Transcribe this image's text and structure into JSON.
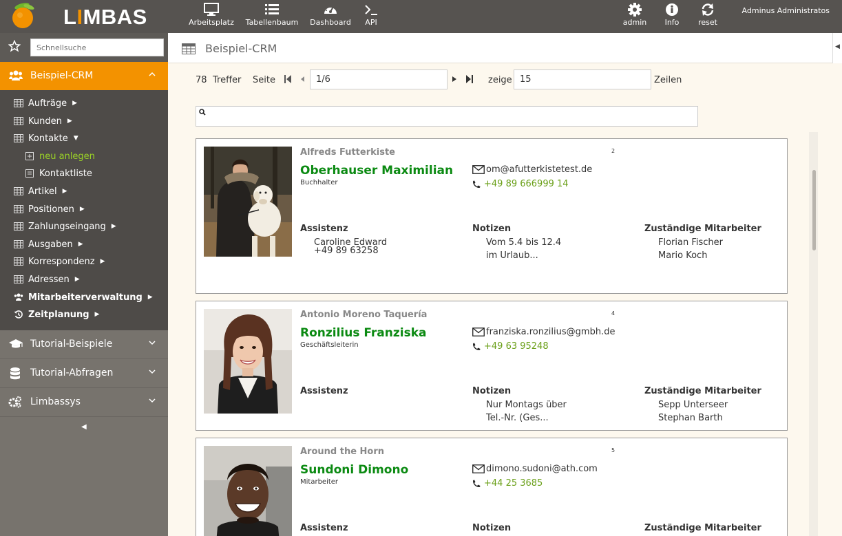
{
  "app": {
    "logo_pre": "L",
    "logo_accent": "I",
    "logo_post": "MBAS",
    "user": "Adminus Administratos"
  },
  "topnav": [
    {
      "label": "Arbeitsplatz",
      "icon": "monitor-icon"
    },
    {
      "label": "Tabellenbaum",
      "icon": "list-icon"
    },
    {
      "label": "Dashboard",
      "icon": "gauge-icon"
    },
    {
      "label": "API",
      "icon": "terminal-icon"
    }
  ],
  "topright": [
    {
      "label": "admin",
      "icon": "gear-icon"
    },
    {
      "label": "Info",
      "icon": "info-icon"
    },
    {
      "label": "reset",
      "icon": "refresh-icon"
    }
  ],
  "sidebar": {
    "search_placeholder": "Schnellsuche",
    "active_section": "Beispiel-CRM",
    "items": [
      {
        "label": "Aufträge"
      },
      {
        "label": "Kunden"
      },
      {
        "label": "Kontakte"
      },
      {
        "label": "neu anlegen"
      },
      {
        "label": "Kontaktliste"
      },
      {
        "label": "Artikel"
      },
      {
        "label": "Positionen"
      },
      {
        "label": "Zahlungseingang"
      },
      {
        "label": "Ausgaben"
      },
      {
        "label": "Korrespondenz"
      },
      {
        "label": "Adressen"
      },
      {
        "label": "Mitarbeiterverwaltung"
      },
      {
        "label": "Zeitplanung"
      }
    ],
    "sections": [
      {
        "label": "Tutorial-Beispiele"
      },
      {
        "label": "Tutorial-Abfragen"
      },
      {
        "label": "Limbassys"
      }
    ]
  },
  "main": {
    "title": "Beispiel-CRM",
    "pager": {
      "count": "78",
      "hits_label": "Treffer",
      "page_label": "Seite",
      "page_value": "1/6",
      "show_label": "zeige",
      "rows_value": "15",
      "rows_label": "Zeilen"
    }
  },
  "labels": {
    "assistant": "Assistenz",
    "notes": "Notizen",
    "staff": "Zuständige Mitarbeiter"
  },
  "cards": [
    {
      "company": "Alfreds Futterkiste",
      "name": "Oberhauser Maximilian",
      "role": "Buchhalter",
      "num": "2",
      "email": "om@afutterkistetest.de",
      "phone": "+49 89 666999 14",
      "assistant": [
        "Caroline Edward",
        "+49 89 63258"
      ],
      "notes": [
        "Vom 5.4 bis 12.4",
        "im Urlaub..."
      ],
      "staff": [
        "Florian Fischer",
        "Mario Koch"
      ]
    },
    {
      "company": "Antonio Moreno Taquería",
      "name": "Ronzilius Franziska",
      "role": "Geschäftsleiterin",
      "num": "4",
      "email": "franziska.ronzilius@gmbh.de",
      "phone": "+49 63 95248",
      "assistant": [],
      "notes": [
        "Nur Montags über",
        "Tel.-Nr. (Ges..."
      ],
      "staff": [
        "Sepp Unterseer",
        "Stephan Barth"
      ]
    },
    {
      "company": "Around the Horn",
      "name": "Sundoni Dimono",
      "role": "Mitarbeiter",
      "num": "5",
      "email": "dimono.sudoni@ath.com",
      "phone": "+44 25 3685",
      "assistant": [],
      "notes": [],
      "staff": []
    }
  ]
}
